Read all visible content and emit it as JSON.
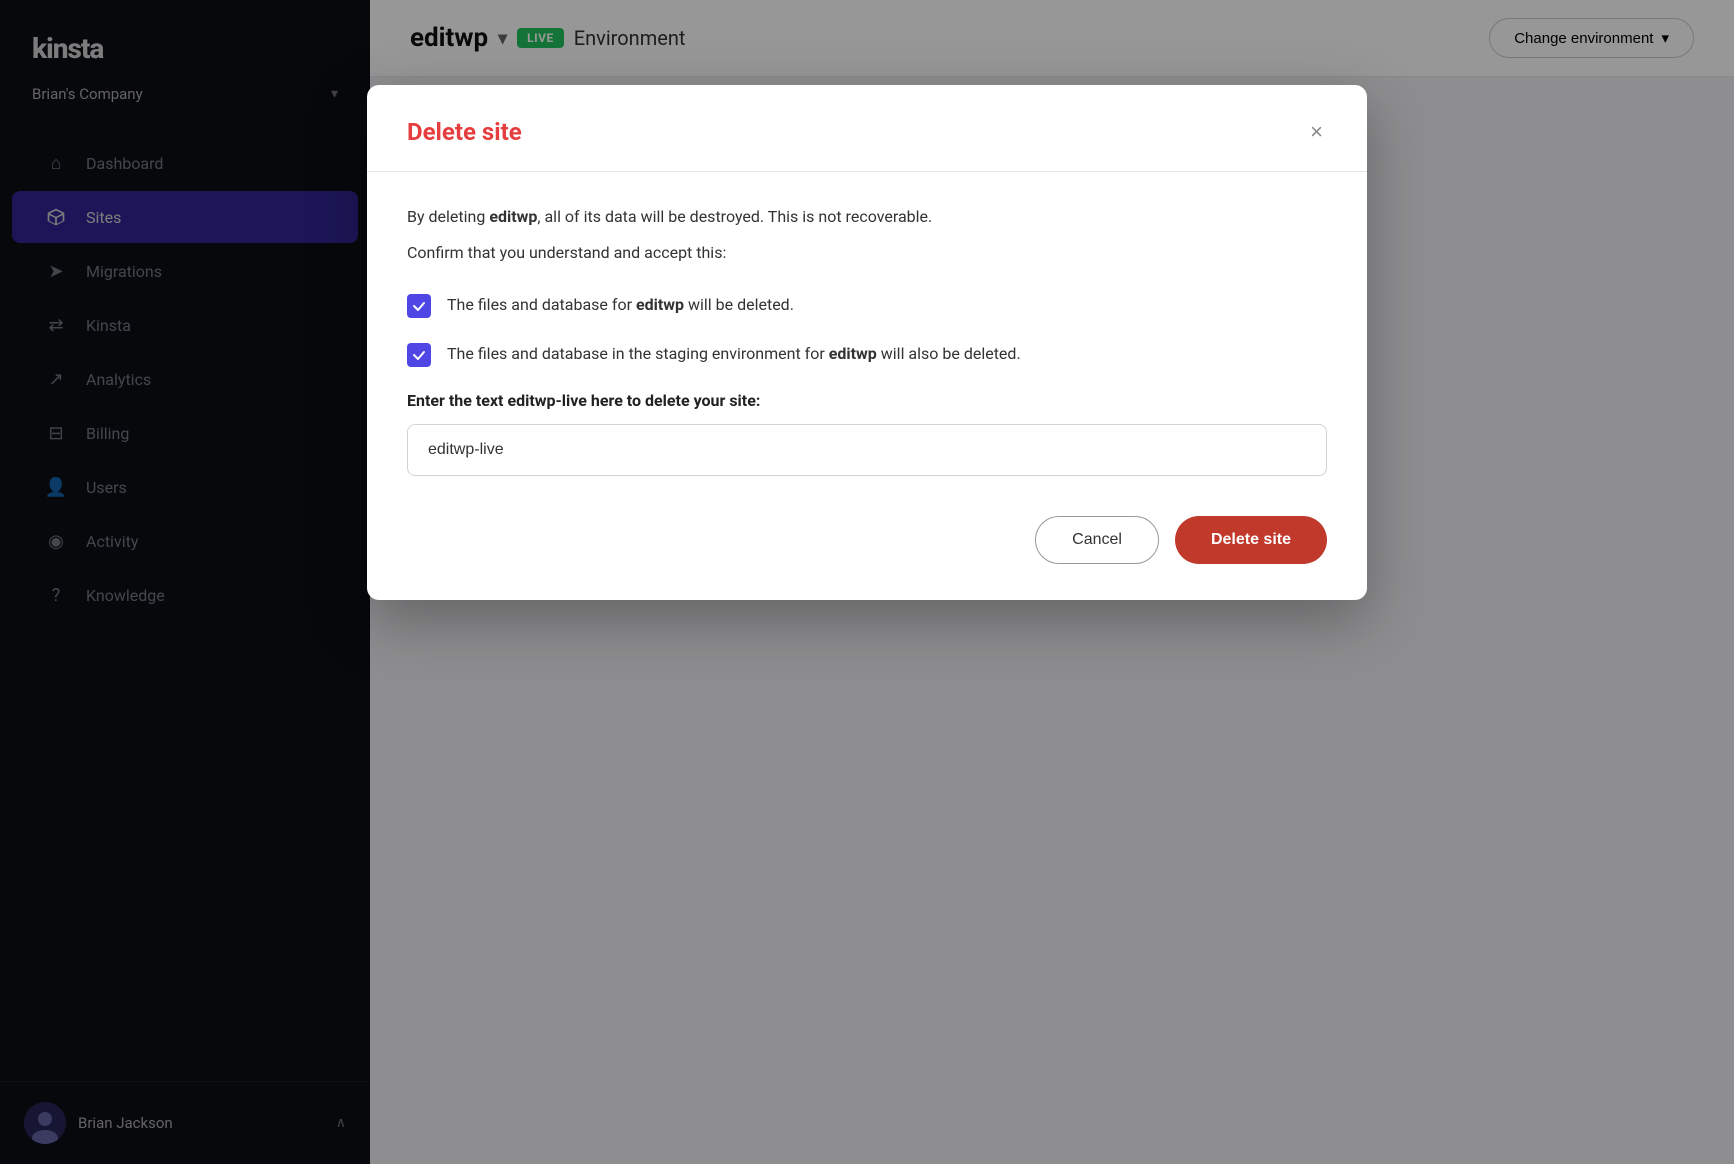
{
  "sidebar": {
    "logo": "kinsta",
    "company": {
      "name": "Brian's Company",
      "chevron": "▾"
    },
    "nav": [
      {
        "id": "dashboard",
        "label": "Dashboard",
        "icon": "⌂",
        "active": false
      },
      {
        "id": "sites",
        "label": "Sites",
        "icon": "◈",
        "active": true
      },
      {
        "id": "migrations",
        "label": "Migrations",
        "icon": "⟶",
        "active": false
      },
      {
        "id": "kinsta",
        "label": "Kinsta",
        "icon": "⇌",
        "active": false
      },
      {
        "id": "analytics",
        "label": "Analytics",
        "icon": "↗",
        "active": false
      },
      {
        "id": "billing",
        "label": "Billing",
        "icon": "⊟",
        "active": false
      },
      {
        "id": "users",
        "label": "Users",
        "icon": "⊕",
        "active": false
      },
      {
        "id": "activity",
        "label": "Activity",
        "icon": "◉",
        "active": false
      },
      {
        "id": "knowledge",
        "label": "Knowledge",
        "icon": "⊘",
        "active": false
      }
    ],
    "user": {
      "name": "Brian Jackson",
      "chevron": "∧"
    }
  },
  "header": {
    "site_name": "editwp",
    "chevron": "▾",
    "live_badge": "LIVE",
    "env_label": "Environment",
    "change_env_label": "Change environment",
    "change_env_chevron": "▾"
  },
  "modal": {
    "title": "Delete site",
    "close_label": "×",
    "description_prefix": "By deleting ",
    "description_site": "editwp",
    "description_suffix": ", all of its data will be destroyed. This is not recoverable.",
    "confirm_text": "Confirm that you understand and accept this:",
    "checkbox1": {
      "label_prefix": "The files and database for ",
      "label_site": "editwp",
      "label_suffix": " will be deleted.",
      "checked": true
    },
    "checkbox2": {
      "label_prefix": "The files and database in the staging environment for ",
      "label_site": "editwp",
      "label_suffix": " will also be deleted.",
      "checked": true
    },
    "input_label": "Enter the text editwp-live here to delete your site:",
    "input_value": "editwp-live",
    "input_placeholder": "editwp-live",
    "cancel_label": "Cancel",
    "delete_label": "Delete site"
  }
}
